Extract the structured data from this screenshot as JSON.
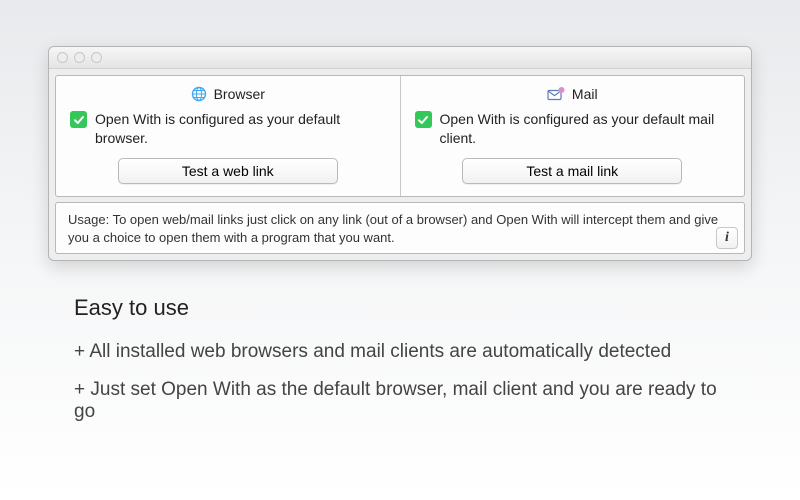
{
  "window": {
    "browser": {
      "title": "Browser",
      "status_text": "Open With is configured as your default browser.",
      "button_label": "Test a web link"
    },
    "mail": {
      "title": "Mail",
      "status_text": "Open With is configured as your default mail client.",
      "button_label": "Test a mail link"
    },
    "usage_text": "Usage: To open web/mail links just click on any link (out of a browser) and Open With will intercept them and give you a choice to open them with a program that you want."
  },
  "marketing": {
    "headline": "Easy to use",
    "feature_1": "+ All installed web browsers and mail clients are automatically detected",
    "feature_2": "+ Just set Open With as the default browser, mail client and you are ready to go"
  }
}
